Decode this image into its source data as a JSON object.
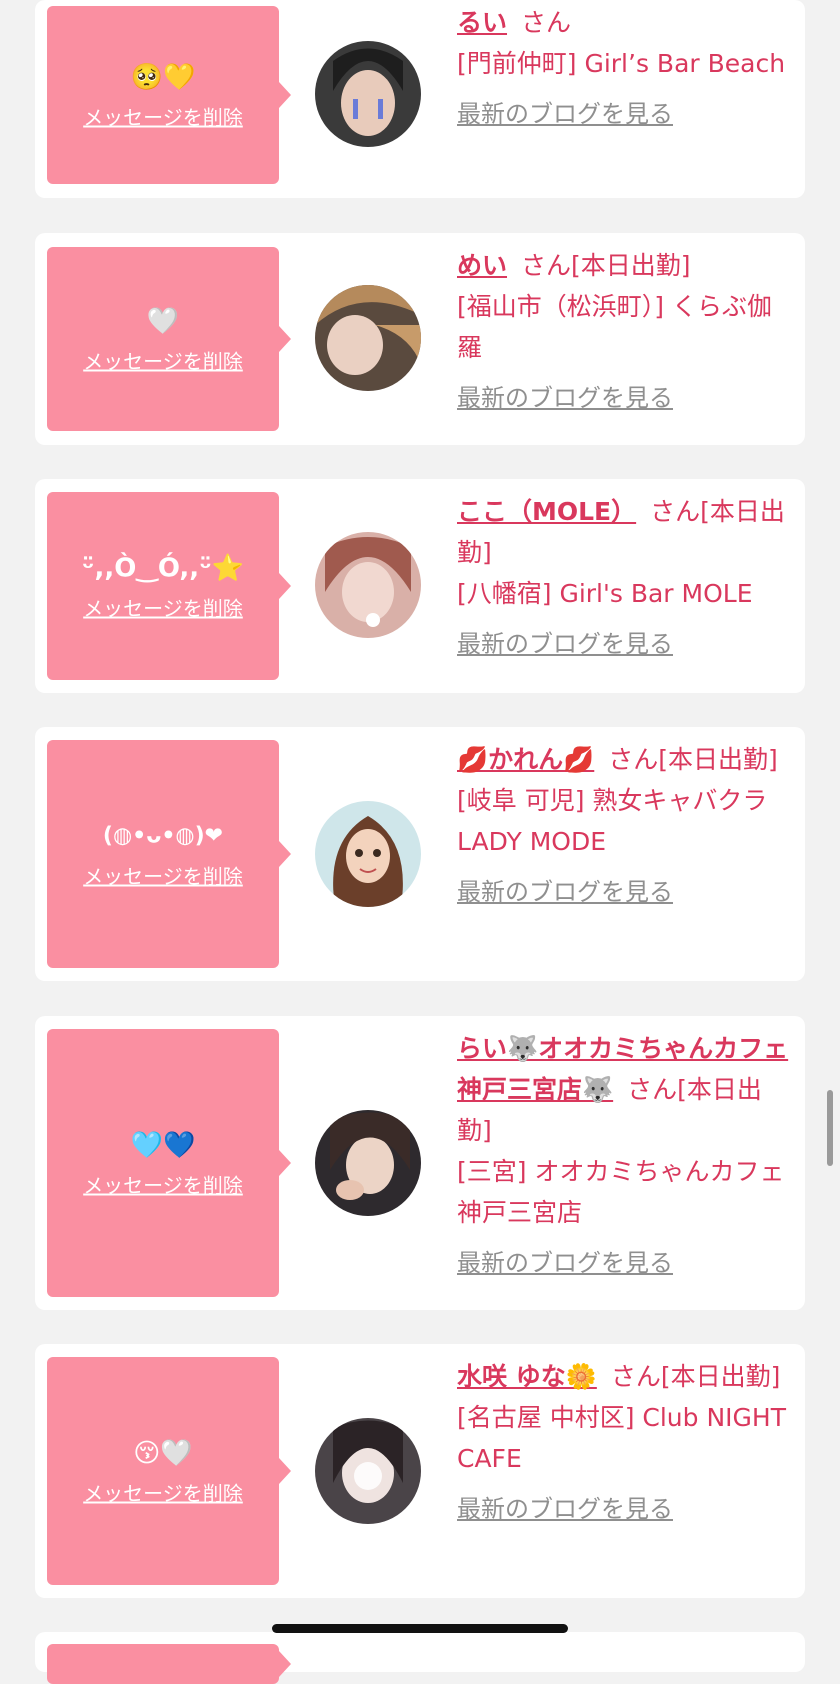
{
  "labels": {
    "delete": "メッセージを削除",
    "blog": "最新のブログを見る",
    "san": "さん"
  },
  "entries": [
    {
      "emoji": "🥺💛",
      "name": "るい",
      "status": "",
      "shop": "[門前仲町] Girl’s Bar Beach"
    },
    {
      "emoji": "🤍",
      "name": "めい",
      "status": "[本日出勤]",
      "shop": "[福山市（松浜町）] くらぶ伽羅"
    },
    {
      "emoji": "ᵕ̈,,Ò‿Ó,,ᵕ̈⭐",
      "name": "ここ（MOLE）",
      "status": "[本日出勤]",
      "shop": "[八幡宿] Girl's Bar MOLE"
    },
    {
      "emoji": "(◍•ᴗ•◍)❤",
      "name": "💋かれん💋",
      "status": "[本日出勤]",
      "shop": "[岐阜 可児] 熟女キャバクラ LADY MODE"
    },
    {
      "emoji": "🩵💙",
      "name": "らい🐺オオカミちゃんカフェ神戸三宮店🐺",
      "status": "[本日出勤]",
      "shop": "[三宮] オオカミちゃんカフェ神戸三宮店"
    },
    {
      "emoji": "😚🤍",
      "name": "水咲 ゆな🌼",
      "status": "[本日出勤]",
      "shop": "[名古屋 中村区] Club NIGHT CAFE"
    }
  ],
  "colors": {
    "accent": "#d9385d",
    "bubble": "#fa8fa1",
    "link_gray": "#8f8f8f",
    "background": "#f2f2f2"
  }
}
